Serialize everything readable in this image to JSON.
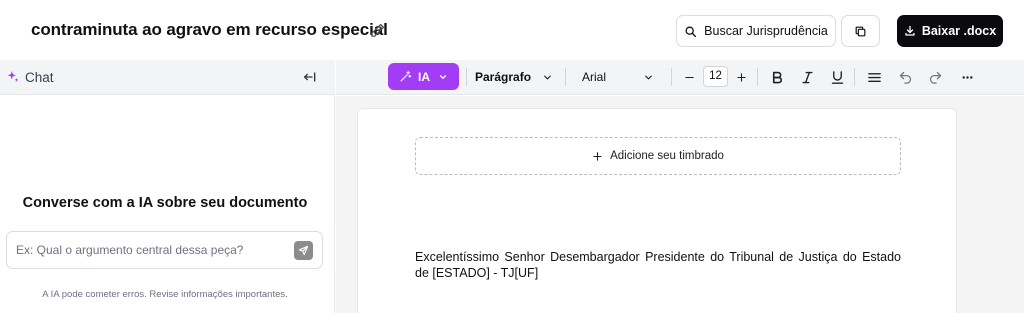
{
  "header": {
    "document_title": "contraminuta ao agravo em recurso especial",
    "search_button": "Buscar Jurisprudência",
    "download_button": "Baixar .docx",
    "icons": [
      "edit-icon",
      "search-icon",
      "copy-icon",
      "download-icon"
    ]
  },
  "chat_panel": {
    "title": "Chat",
    "heading": "Converse com a IA sobre seu documento",
    "input_placeholder": "Ex: Qual o argumento central dessa peça?",
    "disclaimer": "A IA pode cometer erros. Revise informações importantes.",
    "icons": [
      "sparkle-icon",
      "collapse-panel-icon",
      "send-icon"
    ]
  },
  "toolbar": {
    "ia_label": "IA",
    "paragraph_style": "Parágrafo",
    "font_family": "Arial",
    "font_size": "12",
    "accent_color": "#a23cf5",
    "icons": [
      "magic-wand-icon",
      "minus-icon",
      "plus-icon",
      "bold-icon",
      "italic-icon",
      "underline-icon",
      "align-icon",
      "undo-icon",
      "redo-icon",
      "more-icon"
    ]
  },
  "document": {
    "letterhead_label": "Adicione seu timbrado",
    "body_text": "Excelentíssimo Senhor Desembargador Presidente do Tribunal de Justiça do Estado de [ESTADO] - TJ[UF]"
  }
}
